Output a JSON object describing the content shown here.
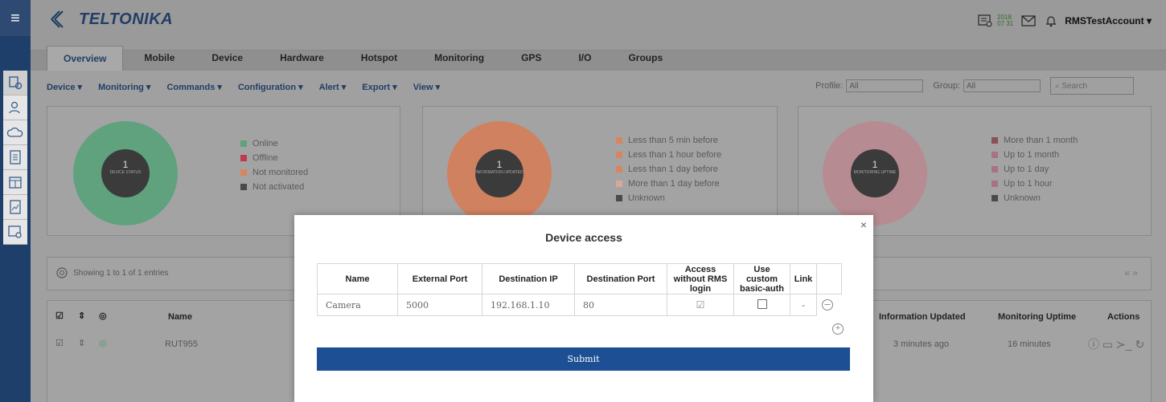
{
  "header": {
    "logo_text": "TELTONIKA",
    "date_year": "2018",
    "date_day": "07 31",
    "account": "RMSTestAccount ▾"
  },
  "tabs": [
    {
      "label": "Overview"
    },
    {
      "label": "Mobile"
    },
    {
      "label": "Device"
    },
    {
      "label": "Hardware"
    },
    {
      "label": "Hotspot"
    },
    {
      "label": "Monitoring"
    },
    {
      "label": "GPS"
    },
    {
      "label": "I/O"
    },
    {
      "label": "Groups"
    }
  ],
  "toolbar": [
    "Device ▾",
    "Monitoring ▾",
    "Commands ▾",
    "Configuration ▾",
    "Alert ▾",
    "Export ▾",
    "View ▾"
  ],
  "filters": {
    "profile_label": "Profile:",
    "profile_value": "All",
    "group_label": "Group:",
    "group_value": "All",
    "search_placeholder": "Search"
  },
  "panels": [
    {
      "count": "1",
      "caption": "DEVICE STATUS",
      "color": "#5fa27d",
      "legend": [
        {
          "label": "Online",
          "color": "#5fa27d"
        },
        {
          "label": "Offline",
          "color": "#c03a4f"
        },
        {
          "label": "Not monitored",
          "color": "#d6865e"
        },
        {
          "label": "Not activated",
          "color": "#4a4a4a"
        }
      ]
    },
    {
      "count": "1",
      "caption": "INFORMATION UPDATED",
      "color": "#d08260",
      "legend": [
        {
          "label": "Less than 5 min before",
          "color": "#d6865e"
        },
        {
          "label": "Less than 1 hour before",
          "color": "#d6865e"
        },
        {
          "label": "Less than 1 day before",
          "color": "#d6865e"
        },
        {
          "label": "More than 1 day before",
          "color": "#d9a79a"
        },
        {
          "label": "Unknown",
          "color": "#4a4a4a"
        }
      ]
    },
    {
      "count": "1",
      "caption": "MONITORING UPTIME",
      "color": "#b78b92",
      "legend": [
        {
          "label": "More than 1 month",
          "color": "#8c4f5a"
        },
        {
          "label": "Up to 1 month",
          "color": "#a87380"
        },
        {
          "label": "Up to 1 day",
          "color": "#a87380"
        },
        {
          "label": "Up to 1 hour",
          "color": "#a87380"
        },
        {
          "label": "Unknown",
          "color": "#4a4a4a"
        }
      ]
    }
  ],
  "entries": {
    "text": "Showing 1 to 1 of 1 entries",
    "pager": "« »"
  },
  "device_table": {
    "headers_left": [
      "Name"
    ],
    "headers_right": [
      "Information Updated",
      "Monitoring Uptime",
      "Actions"
    ],
    "row": {
      "name": "RUT955",
      "info_updated": "3 minutes ago",
      "uptime": "16 minutes"
    }
  },
  "modal": {
    "title": "Device access",
    "close": "×",
    "columns": [
      "Name",
      "External Port",
      "Destination IP",
      "Destination Port",
      "Access without RMS login",
      "Use custom basic-auth",
      "Link",
      ""
    ],
    "rows": [
      {
        "name": "Camera",
        "external_port": "5000",
        "destination_ip": "192.168.1.10",
        "destination_port": "80",
        "access_without_login": true,
        "custom_auth": false,
        "link": "-"
      }
    ],
    "submit_label": "Submit"
  }
}
